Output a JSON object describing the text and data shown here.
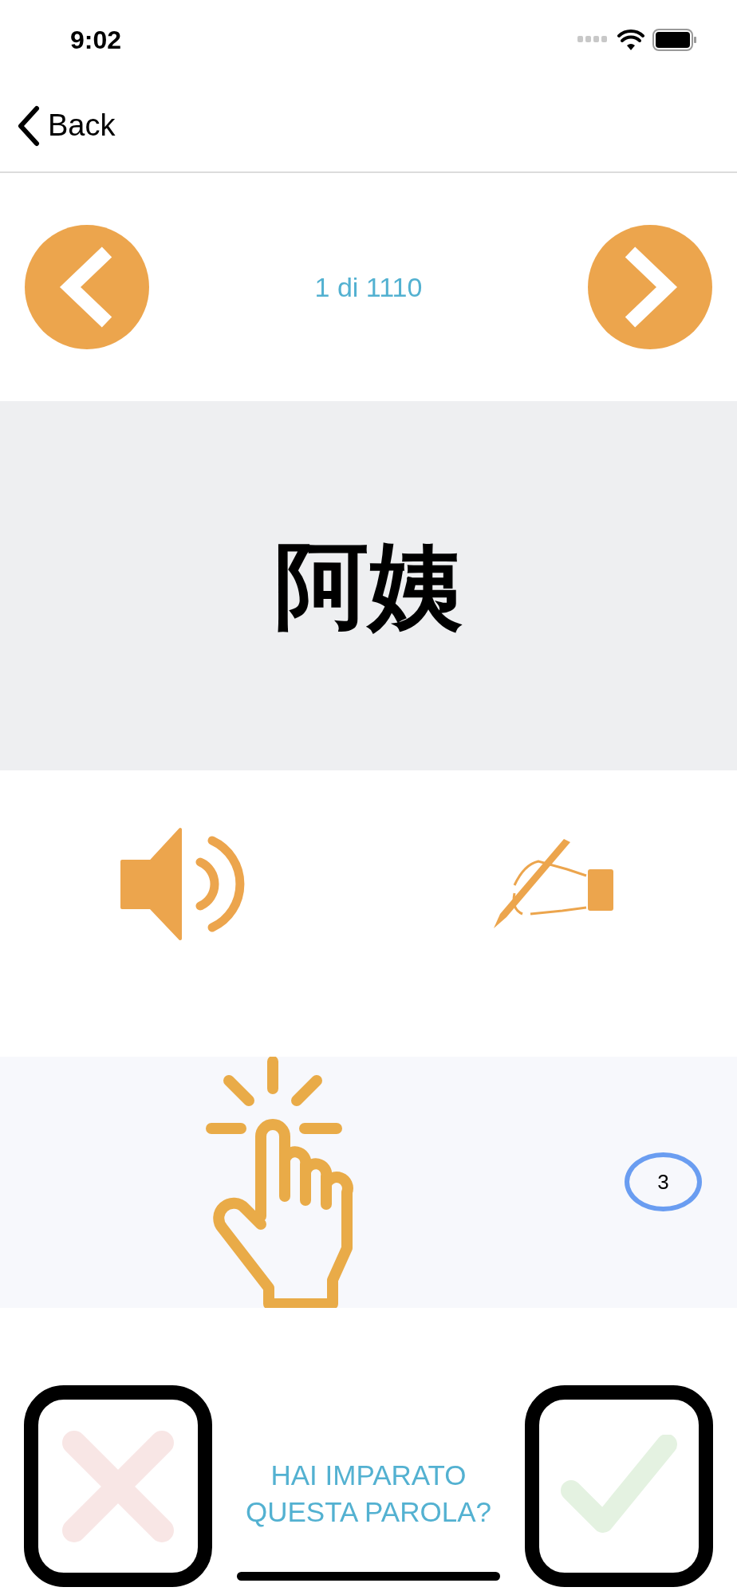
{
  "status_bar": {
    "time": "9:02"
  },
  "nav": {
    "back": "Back"
  },
  "pager": {
    "counter": "1 di 1110"
  },
  "word": "阿姨",
  "tap_count": "3",
  "prompt": {
    "line1": "HAI IMPARATO",
    "line2": "QUESTA PAROLA?"
  }
}
